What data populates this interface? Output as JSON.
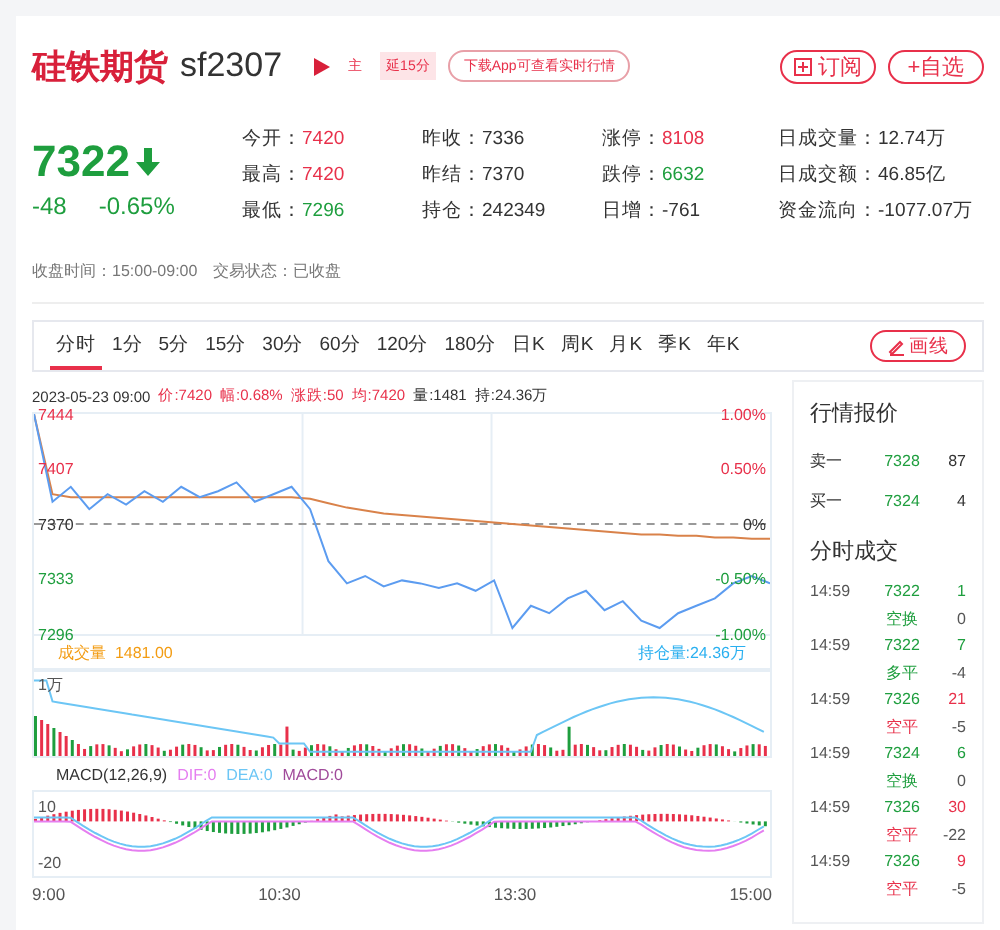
{
  "header": {
    "name": "硅铁期货",
    "code": "sf2307",
    "badges": [
      "主",
      "延15分"
    ],
    "app_link": "下载App可查看实时行情",
    "buttons": [
      {
        "kind": "subscribe",
        "label": "订阅"
      },
      {
        "kind": "add",
        "label": "+自选"
      }
    ]
  },
  "quote": {
    "price": "7322",
    "color": "#1e9e3e",
    "change": "-48",
    "percent": "-0.65%"
  },
  "stats": [
    {
      "label": "今开：",
      "value": "7420",
      "color": "#e8304a"
    },
    {
      "label": "昨收：",
      "value": "7336",
      "color": "#333333"
    },
    {
      "label": "涨停：",
      "value": "8108",
      "color": "#e8304a"
    },
    {
      "label": "日成交量：",
      "value": "12.74万",
      "color": "#333333"
    },
    {
      "label": "最高：",
      "value": "7420",
      "color": "#e8304a"
    },
    {
      "label": "昨结：",
      "value": "7370",
      "color": "#333333"
    },
    {
      "label": "跌停：",
      "value": "6632",
      "color": "#1e9e3e"
    },
    {
      "label": "日成交额：",
      "value": "46.85亿",
      "color": "#333333"
    },
    {
      "label": "最低：",
      "value": "7296",
      "color": "#1e9e3e"
    },
    {
      "label": "持仓：",
      "value": "242349",
      "color": "#333333"
    },
    {
      "label": "日增：",
      "value": "-761",
      "color": "#333333"
    },
    {
      "label": "资金流向：",
      "value": "-1077.07万",
      "color": "#333333"
    }
  ],
  "status": [
    {
      "label": "收盘时间：",
      "value": "15:00-09:00"
    },
    {
      "label": "交易状态：",
      "value": "已收盘"
    }
  ],
  "tabs": [
    {
      "label": "分时",
      "selected": true
    },
    {
      "label": "1分",
      "selected": false
    },
    {
      "label": "5分",
      "selected": false
    },
    {
      "label": "15分",
      "selected": false
    },
    {
      "label": "30分",
      "selected": false
    },
    {
      "label": "60分",
      "selected": false
    },
    {
      "label": "120分",
      "selected": false
    },
    {
      "label": "180分",
      "selected": false
    },
    {
      "label": "日K",
      "selected": false
    },
    {
      "label": "周K",
      "selected": false
    },
    {
      "label": "月K",
      "selected": false
    },
    {
      "label": "季K",
      "selected": false
    },
    {
      "label": "年K",
      "selected": false
    }
  ],
  "draw_button": "画线",
  "info": [
    {
      "text": "2023-05-23 09:00",
      "color": "#333333"
    },
    {
      "text": "价:7420",
      "color": "#e8304a"
    },
    {
      "text": "幅:0.68%",
      "color": "#e8304a"
    },
    {
      "text": "涨跌:50",
      "color": "#e8304a"
    },
    {
      "text": "均:7420",
      "color": "#e8304a"
    },
    {
      "text": "量:1481",
      "color": "#333333"
    },
    {
      "text": "持:24.36万",
      "color": "#333333"
    }
  ],
  "price_chart": {
    "chart_data": {
      "type": "line",
      "ylim": [
        7296,
        7444
      ],
      "yticks": [
        {
          "value": 7444,
          "label": "7444"
        },
        {
          "value": 7407,
          "label": "7407"
        },
        {
          "value": 7370,
          "label": "7370"
        },
        {
          "value": 7333,
          "label": "7333"
        },
        {
          "value": 7296,
          "label": "7296"
        }
      ],
      "series": [
        {
          "color": "#5c9cf0",
          "values": [
            7444,
            7385,
            7395,
            7380,
            7390,
            7383,
            7392,
            7385,
            7395,
            7388,
            7392,
            7398,
            7385,
            7390,
            7395,
            7380,
            7345,
            7330,
            7335,
            7328,
            7332,
            7330,
            7327,
            7330,
            7325,
            7332,
            7300,
            7315,
            7310,
            7320,
            7325,
            7312,
            7318,
            7305,
            7300,
            7310,
            7315,
            7320,
            7330,
            7335,
            7330
          ]
        },
        {
          "color": "#d9824a",
          "values": [
            7444,
            7390,
            7388,
            7388,
            7388,
            7388,
            7388,
            7388,
            7388,
            7388,
            7388,
            7388,
            7388,
            7388,
            7388,
            7387,
            7384,
            7381,
            7379,
            7377,
            7376,
            7375,
            7374,
            7373,
            7372,
            7371,
            7370,
            7369,
            7368,
            7367,
            7366,
            7365,
            7364,
            7363,
            7363,
            7362,
            7362,
            7361,
            7361,
            7360,
            7360
          ]
        },
        {
          "color": "#999999",
          "line_style": "dashed",
          "values": [
            7370,
            7370,
            7370,
            7370,
            7370,
            7370,
            7370,
            7370,
            7370,
            7370,
            7370,
            7370,
            7370,
            7370,
            7370,
            7370,
            7370,
            7370,
            7370,
            7370,
            7370,
            7370,
            7370,
            7370,
            7370,
            7370,
            7370,
            7370,
            7370,
            7370,
            7370,
            7370,
            7370,
            7370,
            7370,
            7370,
            7370,
            7370,
            7370,
            7370,
            7370
          ]
        }
      ]
    },
    "percent_labels": [
      {
        "label": "1.00%",
        "color": "#e8304a"
      },
      {
        "label": "0.50%",
        "color": "#e8304a"
      },
      {
        "label": "0%",
        "color": "#333333"
      },
      {
        "label": "-0.50%",
        "color": "#1e9e3e"
      },
      {
        "label": "-1.00%",
        "color": "#1e9e3e"
      }
    ]
  },
  "volume_header": {
    "label": "成交量",
    "value": "1481.00",
    "oi": "持仓量:24.36万"
  },
  "volume_axis": "1万",
  "macd_header": [
    {
      "kind": "name",
      "text": "MACD(12,26,9)"
    },
    {
      "kind": "dif",
      "text": "DIF:0"
    },
    {
      "kind": "dea",
      "text": "DEA:0"
    },
    {
      "kind": "macd",
      "text": "MACD:0"
    }
  ],
  "macd_axis": [
    "10",
    "-20"
  ],
  "time_axis": [
    "9:00",
    "10:30",
    "13:30",
    "15:00"
  ],
  "book": {
    "title": "行情报价",
    "rows": [
      {
        "side": "卖一",
        "price": "7328",
        "volume": "87"
      },
      {
        "side": "买一",
        "price": "7324",
        "volume": "4"
      }
    ]
  },
  "trades": {
    "title": "分时成交",
    "rows": [
      {
        "time": "14:59",
        "price": "7322",
        "volume": "1",
        "color": "#1e9e3e",
        "type": "空换",
        "change": "0"
      },
      {
        "time": "14:59",
        "price": "7322",
        "volume": "7",
        "color": "#1e9e3e",
        "type": "多平",
        "change": "-4"
      },
      {
        "time": "14:59",
        "price": "7326",
        "volume": "21",
        "color": "#e8304a",
        "type": "空平",
        "change": "-5"
      },
      {
        "time": "14:59",
        "price": "7324",
        "volume": "6",
        "color": "#1e9e3e",
        "type": "空换",
        "change": "0"
      },
      {
        "time": "14:59",
        "price": "7326",
        "volume": "30",
        "color": "#e8304a",
        "type": "空平",
        "change": "-22"
      },
      {
        "time": "14:59",
        "price": "7326",
        "volume": "9",
        "color": "#e8304a",
        "type": "空平",
        "change": "-5"
      }
    ]
  }
}
